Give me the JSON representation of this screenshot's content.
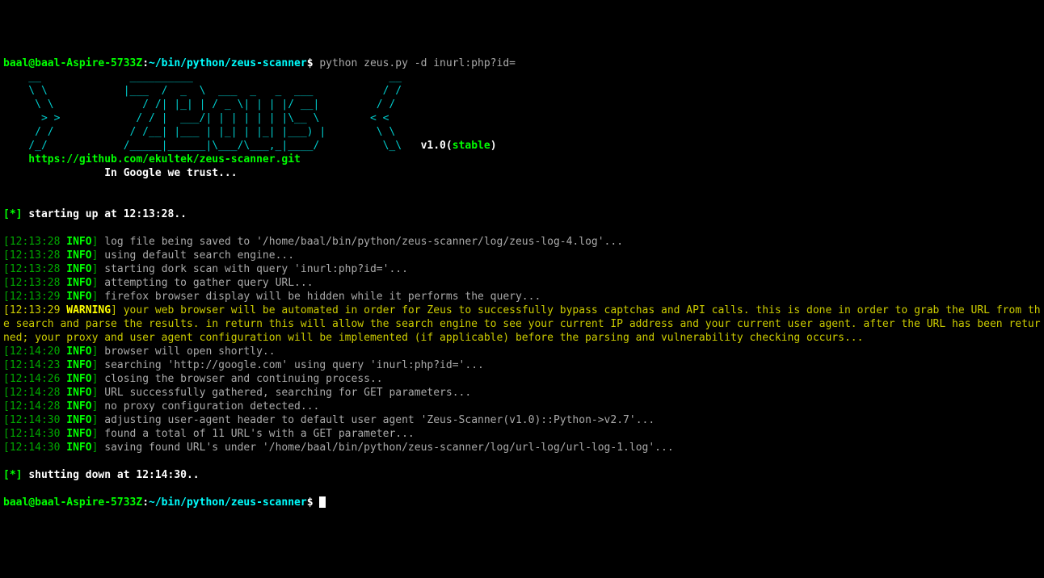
{
  "prompt": {
    "user_host": "baal@baal-Aspire-5733Z",
    "colon": ":",
    "path": "~/bin/python/zeus-scanner",
    "dollar": "$",
    "command": " python zeus.py -d inurl:php?id="
  },
  "ascii": {
    "l1": "   __          __________                      __ ",
    "l2": "   \\ \\        |___  /  _  \\            _   _  / /",
    "l3": "    \\ \\          / /| | | |           | | | |/ /",
    "l4": "     > >        / / | | | |           | | | < <",
    "l5": "    / /        / /__| |_| |           | |_| |\\ \\",
    "l6": "   /_/        /_____|\\___/            \\___,_| \\_\\",
    "under1": "    ___  _   _ ___",
    "under2": "   / _ \\| | | / __|",
    "under3": "  |  __/| |_| \\__ \\",
    "under4": "   \\___| \\__,_|___/",
    "version_prefix": "   v1.0(",
    "version_word": "stable",
    "version_suffix": ")",
    "url": "    https://github.com/ekultek/zeus-scanner.git",
    "tagline": "                In Google we trust..."
  },
  "startup": {
    "prefix": "[*] ",
    "text": "starting up at 12:13:28.."
  },
  "logs": [
    {
      "ts": "12:13:28",
      "level": "INFO",
      "msg": " log file being saved to '/home/baal/bin/python/zeus-scanner/log/zeus-log-4.log'..."
    },
    {
      "ts": "12:13:28",
      "level": "INFO",
      "msg": " using default search engine..."
    },
    {
      "ts": "12:13:28",
      "level": "INFO",
      "msg": " starting dork scan with query 'inurl:php?id='..."
    },
    {
      "ts": "12:13:28",
      "level": "INFO",
      "msg": " attempting to gather query URL..."
    },
    {
      "ts": "12:13:29",
      "level": "INFO",
      "msg": " firefox browser display will be hidden while it performs the query..."
    },
    {
      "ts": "12:13:29",
      "level": "WARNING",
      "msg": " your web browser will be automated in order for Zeus to successfully bypass captchas and API calls. this is done in order to grab the URL from the search and parse the results. in return this will allow the search engine to see your current IP address and your current user agent. after the URL has been returned; your proxy and user agent configuration will be implemented (if applicable) before the parsing and vulnerability checking occurs..."
    },
    {
      "ts": "12:14:20",
      "level": "INFO",
      "msg": " browser will open shortly.."
    },
    {
      "ts": "12:14:23",
      "level": "INFO",
      "msg": " searching 'http://google.com' using query 'inurl:php?id='..."
    },
    {
      "ts": "12:14:26",
      "level": "INFO",
      "msg": " closing the browser and continuing process.."
    },
    {
      "ts": "12:14:28",
      "level": "INFO",
      "msg": " URL successfully gathered, searching for GET parameters..."
    },
    {
      "ts": "12:14:28",
      "level": "INFO",
      "msg": " no proxy configuration detected..."
    },
    {
      "ts": "12:14:30",
      "level": "INFO",
      "msg": " adjusting user-agent header to default user agent 'Zeus-Scanner(v1.0)::Python->v2.7'..."
    },
    {
      "ts": "12:14:30",
      "level": "INFO",
      "msg": " found a total of 11 URL's with a GET parameter..."
    },
    {
      "ts": "12:14:30",
      "level": "INFO",
      "msg": " saving found URL's under '/home/baal/bin/python/zeus-scanner/log/url-log/url-log-1.log'..."
    }
  ],
  "shutdown": {
    "prefix": "[*] ",
    "text": "shutting down at 12:14:30.."
  }
}
